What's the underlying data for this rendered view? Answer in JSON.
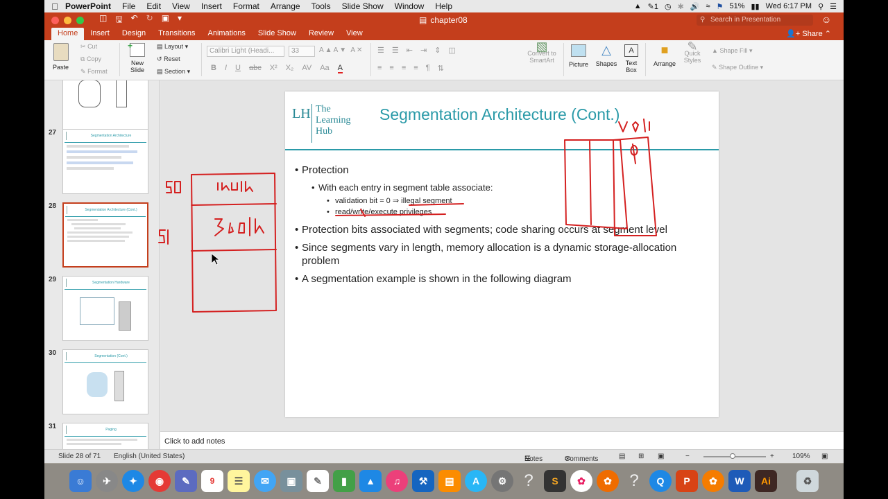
{
  "menubar": {
    "app": "PowerPoint",
    "items": [
      "File",
      "Edit",
      "View",
      "Insert",
      "Format",
      "Arrange",
      "Tools",
      "Slide Show",
      "Window",
      "Help"
    ],
    "battery": "51%",
    "clock": "Wed 6:17 PM",
    "notif_count": "1"
  },
  "window": {
    "doc_title": "chapter08",
    "search_placeholder": "Search in Presentation"
  },
  "ribbon_tabs": [
    "Home",
    "Insert",
    "Design",
    "Transitions",
    "Animations",
    "Slide Show",
    "Review",
    "View"
  ],
  "share_label": "Share",
  "ribbon": {
    "paste": "Paste",
    "cut": "Cut",
    "copy": "Copy",
    "format": "Format",
    "new_slide": "New Slide",
    "layout": "Layout",
    "reset": "Reset",
    "section": "Section",
    "font_name": "Calibri Light (Headi...",
    "font_size": "33",
    "convert": "Convert to SmartArt",
    "picture": "Picture",
    "shapes": "Shapes",
    "text_box": "Text Box",
    "arrange": "Arrange",
    "quick_styles": "Quick Styles",
    "shape_fill": "Shape Fill",
    "shape_outline": "Shape Outline"
  },
  "thumbnails": [
    {
      "num": "27",
      "title": "Segmentation Architecture"
    },
    {
      "num": "28",
      "title": "Segmentation Architecture (Cont.)",
      "selected": true
    },
    {
      "num": "29",
      "title": "Segmentation Hardware"
    },
    {
      "num": "30",
      "title": "Segmentation (Cont.)"
    },
    {
      "num": "31",
      "title": "Paging"
    }
  ],
  "slide": {
    "title": "Segmentation Architecture (Cont.)",
    "logo_initials": "LH",
    "logo_words": [
      "The",
      "Learning",
      "Hub"
    ],
    "bullets": {
      "b1": "Protection",
      "b1_sub": "With each entry in segment table associate:",
      "b1_sub_a": "validation bit = 0 ⇒ illegal segment",
      "b1_sub_b": "read/write/execute privileges",
      "b2": "Protection bits associated with segments; code sharing occurs at segment level",
      "b3": "Since segments vary in length, memory allocation is a dynamic storage-allocation problem",
      "b4": "A segmentation example is shown in the following diagram"
    }
  },
  "notes_placeholder": "Click to add notes",
  "status": {
    "slide_of": "Slide 28 of 71",
    "language": "English (United States)",
    "notes_btn": "Notes",
    "comments_btn": "Comments",
    "zoom": "109%"
  },
  "colors": {
    "accent": "#c43e1c",
    "teal": "#2a9aa8",
    "ink": "#d42020"
  }
}
